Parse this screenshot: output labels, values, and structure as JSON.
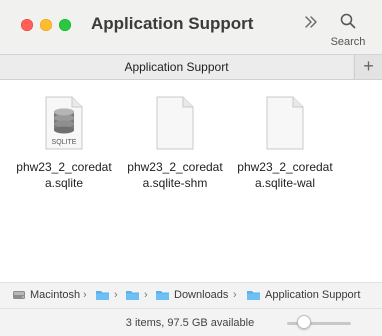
{
  "window": {
    "title": "Application Support",
    "controls": {
      "close_color": "#ff5f57",
      "minimize_color": "#febc2e",
      "zoom_color": "#28c840"
    }
  },
  "toolbar": {
    "more_icon": "chevron-double-right-icon",
    "search_label": "Search",
    "search_icon": "magnifying-glass-icon"
  },
  "tabs": {
    "active_label": "Application Support",
    "add_label": "+"
  },
  "files": [
    {
      "name": "phw23_2_coredata.sqlite",
      "icon": "sqlite-database-icon",
      "badge": "SQLITE"
    },
    {
      "name": "phw23_2_coredata.sqlite-shm",
      "icon": "document-icon"
    },
    {
      "name": "phw23_2_coredata.sqlite-wal",
      "icon": "document-icon"
    }
  ],
  "path_bar": {
    "items": [
      {
        "label": "Macintosh",
        "icon": "hard-drive-icon"
      },
      {
        "label": "",
        "icon": "folder-icon"
      },
      {
        "label": "",
        "icon": "folder-icon"
      },
      {
        "label": "Downloads",
        "icon": "folder-icon"
      },
      {
        "label": "Application Support",
        "icon": "folder-icon"
      }
    ],
    "separator": "›"
  },
  "status_bar": {
    "text": "3 items, 97.5 GB available",
    "icon_size_slider": 0.2
  }
}
